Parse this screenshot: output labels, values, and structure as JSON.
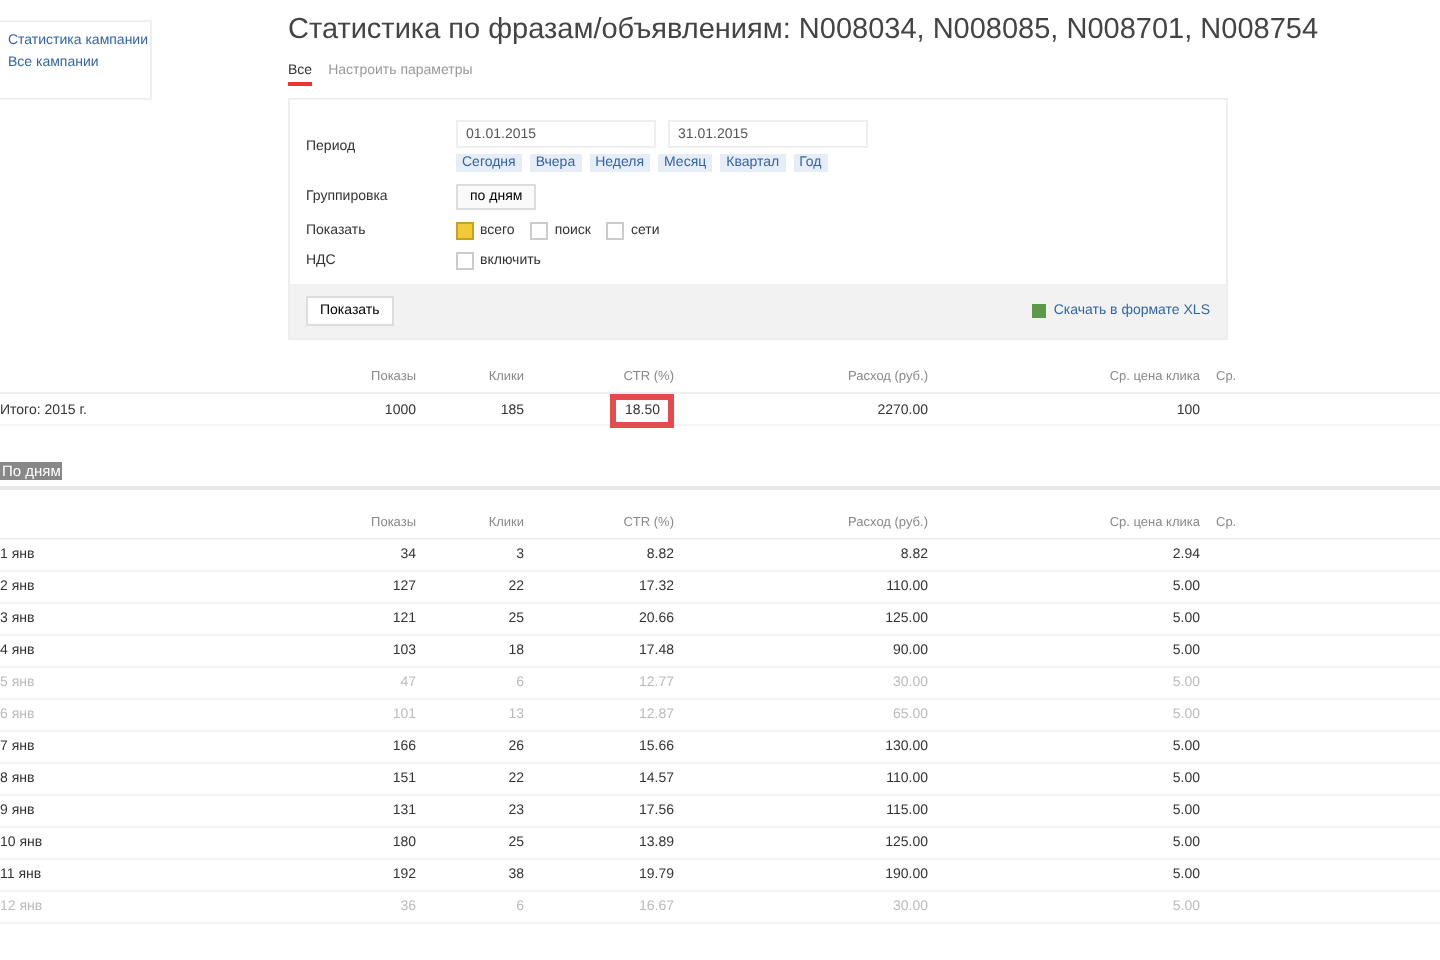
{
  "sidebar": {
    "links": [
      "Статистика кампании",
      "Все кампании"
    ]
  },
  "title": "Статистика по фразам/объявлениям: N008034, N008085, N008701, N008754",
  "tabs": [
    {
      "label": "Все",
      "selected": true
    },
    {
      "label": "Настроить параметры",
      "selected": false
    }
  ],
  "filter": {
    "period_label": "Период",
    "date_from": "01.01.2015",
    "date_to": "31.01.2015",
    "quick_links": [
      "Сегодня",
      "Вчера",
      "Неделя",
      "Месяц",
      "Квартал",
      "Год"
    ],
    "grouping_label": "Группировка",
    "grouping_value": "по дням",
    "show_label": "Показать",
    "show_options": [
      {
        "label": "всего",
        "checked": true
      },
      {
        "label": "поиск",
        "checked": false
      },
      {
        "label": "сети",
        "checked": false
      }
    ],
    "vat_label": "НДС",
    "vat_option": {
      "label": "включить",
      "checked": false
    },
    "submit": "Показать",
    "export": "Скачать в формате XLS"
  },
  "total_columns": [
    "Показы",
    "Клики",
    "CTR (%)",
    "Расход (руб.)",
    "Ср. цена клика",
    "Ср."
  ],
  "total": {
    "label": "Итого: 2015 г.",
    "cells": [
      {
        "value": "1000",
        "highlighted": false
      },
      {
        "value": "185",
        "highlighted": false
      },
      {
        "value": "18.50",
        "highlighted": true
      },
      {
        "value": "2270.00",
        "highlighted": false
      },
      {
        "value": "100",
        "highlighted": false
      }
    ]
  },
  "section": "По дням",
  "day_columns": [
    "Показы",
    "Клики",
    "CTR (%)",
    "Расход (руб.)",
    "Ср. цена клика",
    "Ср."
  ],
  "rows": [
    {
      "label": "1 янв",
      "weekend": false,
      "cells": [
        "34",
        "3",
        "8.82",
        "8.82",
        "2.94"
      ]
    },
    {
      "label": "2 янв",
      "weekend": false,
      "cells": [
        "127",
        "22",
        "17.32",
        "110.00",
        "5.00"
      ]
    },
    {
      "label": "3 янв",
      "weekend": false,
      "cells": [
        "121",
        "25",
        "20.66",
        "125.00",
        "5.00"
      ]
    },
    {
      "label": "4 янв",
      "weekend": false,
      "cells": [
        "103",
        "18",
        "17.48",
        "90.00",
        "5.00"
      ]
    },
    {
      "label": "5 янв",
      "weekend": true,
      "cells": [
        "47",
        "6",
        "12.77",
        "30.00",
        "5.00"
      ]
    },
    {
      "label": "6 янв",
      "weekend": true,
      "cells": [
        "101",
        "13",
        "12.87",
        "65.00",
        "5.00"
      ]
    },
    {
      "label": "7 янв",
      "weekend": false,
      "cells": [
        "166",
        "26",
        "15.66",
        "130.00",
        "5.00"
      ]
    },
    {
      "label": "8 янв",
      "weekend": false,
      "cells": [
        "151",
        "22",
        "14.57",
        "110.00",
        "5.00"
      ]
    },
    {
      "label": "9 янв",
      "weekend": false,
      "cells": [
        "131",
        "23",
        "17.56",
        "115.00",
        "5.00"
      ]
    },
    {
      "label": "10 янв",
      "weekend": false,
      "cells": [
        "180",
        "25",
        "13.89",
        "125.00",
        "5.00"
      ]
    },
    {
      "label": "11 янв",
      "weekend": false,
      "cells": [
        "192",
        "38",
        "19.79",
        "190.00",
        "5.00"
      ]
    },
    {
      "label": "12 янв",
      "weekend": true,
      "cells": [
        "36",
        "6",
        "16.67",
        "30.00",
        "5.00"
      ]
    }
  ]
}
